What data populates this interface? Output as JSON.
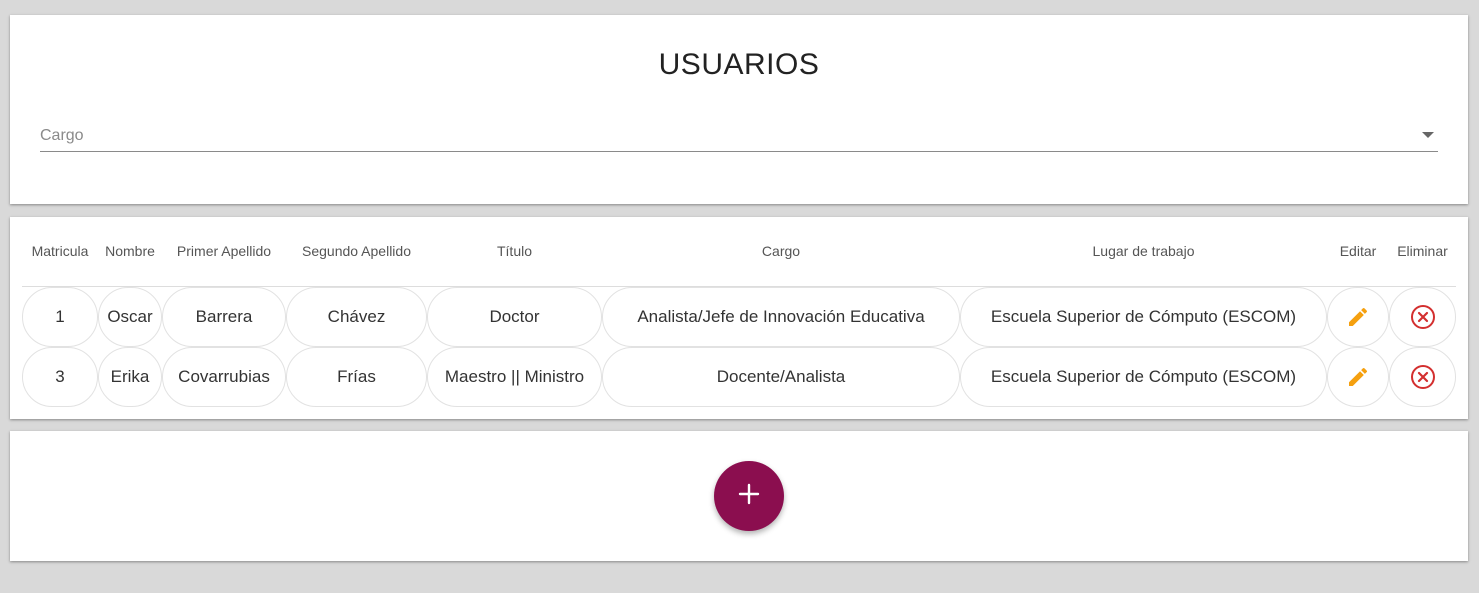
{
  "header": {
    "title": "USUARIOS",
    "cargo_select": {
      "label": "Cargo"
    }
  },
  "table": {
    "columns": {
      "matricula": "Matricula",
      "nombre": "Nombre",
      "primer_apellido": "Primer Apellido",
      "segundo_apellido": "Segundo Apellido",
      "titulo": "Título",
      "cargo": "Cargo",
      "lugar": "Lugar de trabajo",
      "editar": "Editar",
      "eliminar": "Eliminar"
    },
    "rows": [
      {
        "matricula": "1",
        "nombre": "Oscar",
        "primer_apellido": "Barrera",
        "segundo_apellido": "Chávez",
        "titulo": "Doctor",
        "cargo": "Analista/Jefe de Innovación Educativa",
        "lugar": "Escuela Superior de Cómputo (ESCOM)"
      },
      {
        "matricula": "3",
        "nombre": "Erika",
        "primer_apellido": "Covarrubias",
        "segundo_apellido": "Frías",
        "titulo": "Maestro || Ministro",
        "cargo": "Docente/Analista",
        "lugar": "Escuela Superior de Cómputo (ESCOM)"
      }
    ]
  },
  "icons": {
    "edit": "pencil-icon",
    "delete": "close-circle-icon",
    "add": "plus-icon",
    "dropdown": "caret-down-icon"
  },
  "colors": {
    "background": "#d9d9d9",
    "edit_icon": "#f5a00f",
    "delete_icon": "#d32f2f",
    "fab": "#8b0e4f"
  }
}
